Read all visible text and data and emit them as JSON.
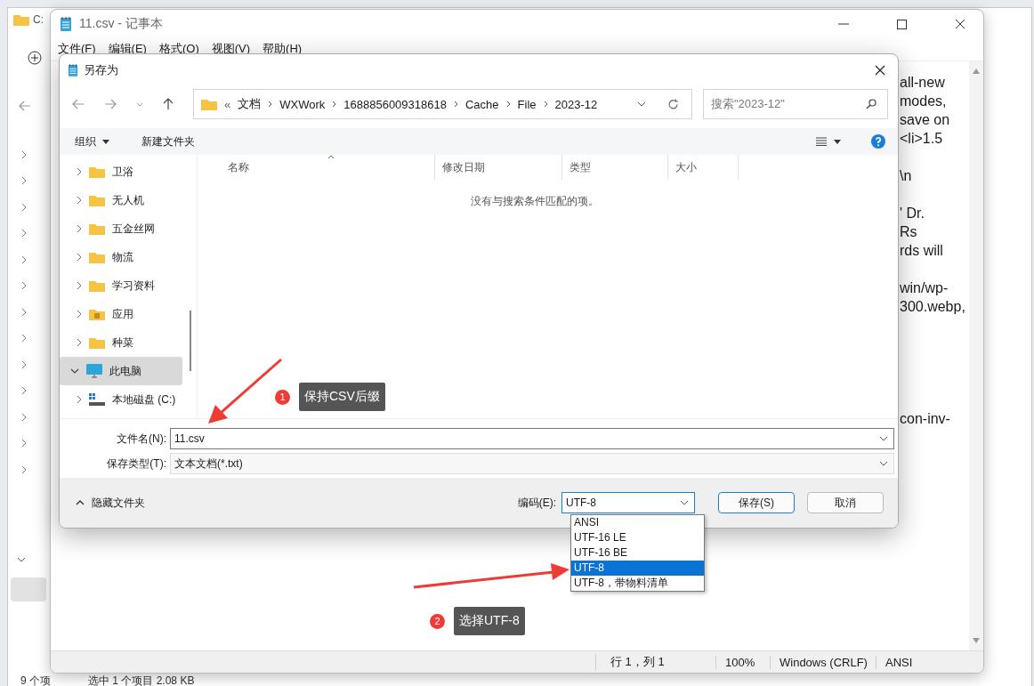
{
  "explorer_window": {
    "title": "C:",
    "status_items": [
      "9 个项",
      "选中 1 个项目  2.08 KB"
    ]
  },
  "notepad": {
    "title": "11.csv - 记事本",
    "menu": [
      "文件(F)",
      "编辑(E)",
      "格式(O)",
      "视图(V)",
      "帮助(H)"
    ],
    "text_paragraphs": [
      [
        "all-new",
        "modes,",
        "save on",
        "<li>1.5"
      ],
      [
        "\\n"
      ],
      [
        "' Dr.",
        "Rs",
        "rds will"
      ],
      [
        "win/wp-",
        "300.webp,"
      ],
      [
        "con-inv-"
      ]
    ],
    "status": [
      "行 1，列 1",
      "100%",
      "Windows (CRLF)",
      "ANSI"
    ]
  },
  "save_dialog": {
    "title": "另存为",
    "breadcrumb": [
      "«",
      "文档",
      "WXWork",
      "1688856009318618",
      "Cache",
      "File",
      "2023-12"
    ],
    "search": {
      "placeholder": "搜索\"2023-12\""
    },
    "toolbar": {
      "organize": "组织",
      "new_folder": "新建文件夹"
    },
    "tree": [
      {
        "label": "卫浴",
        "kind": "folder",
        "expanded": false,
        "selected": false
      },
      {
        "label": "无人机",
        "kind": "folder",
        "expanded": false,
        "selected": false
      },
      {
        "label": "五金丝网",
        "kind": "folder",
        "expanded": false,
        "selected": false
      },
      {
        "label": "物流",
        "kind": "folder",
        "expanded": false,
        "selected": false
      },
      {
        "label": "学习资料",
        "kind": "folder",
        "expanded": false,
        "selected": false
      },
      {
        "label": "应用",
        "kind": "app-folder",
        "expanded": false,
        "selected": false
      },
      {
        "label": "种菜",
        "kind": "folder",
        "expanded": false,
        "selected": false
      },
      {
        "label": "此电脑",
        "kind": "computer",
        "expanded": true,
        "selected": true
      },
      {
        "label": "本地磁盘 (C:)",
        "kind": "drive",
        "expanded": false,
        "selected": false
      }
    ],
    "columns": [
      "名称",
      "修改日期",
      "类型",
      "大小"
    ],
    "empty_message": "没有与搜索条件匹配的项。",
    "file_name": {
      "label": "文件名(N):",
      "value": "11.csv"
    },
    "save_type": {
      "label": "保存类型(T):",
      "value": "文本文档(*.txt)"
    },
    "hide_folders": "隐藏文件夹",
    "encoding": {
      "label": "编码(E):",
      "value": "UTF-8",
      "expanded": true,
      "options": [
        {
          "label": "ANSI",
          "selected": false
        },
        {
          "label": "UTF-16 LE",
          "selected": false
        },
        {
          "label": "UTF-16 BE",
          "selected": false
        },
        {
          "label": "UTF-8",
          "selected": true
        },
        {
          "label": "UTF-8，带物料清单",
          "selected": false
        }
      ]
    },
    "buttons": [
      "保存(S)",
      "取消"
    ]
  },
  "annotations": [
    {
      "number": "1",
      "text": "保持CSV后缀"
    },
    {
      "number": "2",
      "text": "选择UTF-8"
    }
  ]
}
